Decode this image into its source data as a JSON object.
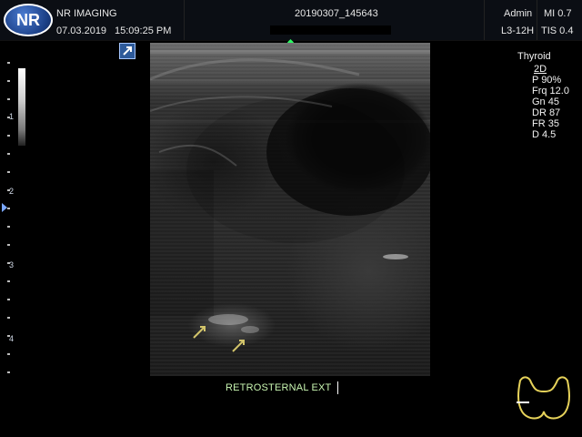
{
  "header": {
    "logo_text": "NR",
    "clinic_name": "NR IMAGING",
    "date": "07.03.2019",
    "time": "15:09:25 PM",
    "study_id": "20190307_145643",
    "user": "Admin",
    "probe": "L3-12H",
    "mi": "MI 0.7",
    "tis": "TIS 0.4"
  },
  "depth_scale": {
    "labels": [
      "1",
      "2",
      "3",
      "4"
    ]
  },
  "right_panel": {
    "preset": "Thyroid",
    "mode": "2D",
    "params": [
      "P 90%",
      "Frq 12.0",
      "Gn 45",
      "DR 87",
      "FR 35",
      "D 4.5"
    ]
  },
  "annotation": {
    "text": "RETROSTERNAL EXT"
  },
  "icons": {
    "orientation": "orientation-icon",
    "arrows": [
      "arrow-marker-icon",
      "arrow-marker-icon"
    ],
    "bodymark": "thyroid-bodymark-icon"
  },
  "colors": {
    "annotation": "#c8f5b0",
    "arrows": "#d2c46a",
    "bodymark": "#e6d25a",
    "header_bg": "#0b0e14",
    "marker_green": "#2aff64"
  }
}
